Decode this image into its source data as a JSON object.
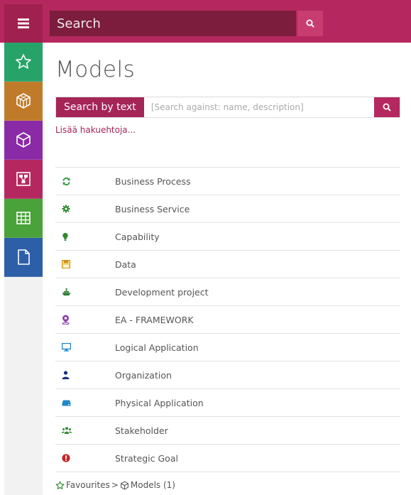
{
  "topbar": {
    "search_placeholder": "Search",
    "menu_icon": "hamburger-icon",
    "search_icon": "search-icon",
    "color": "#b5285f"
  },
  "sidebar": {
    "items": [
      {
        "name": "favourites",
        "icon": "star-icon",
        "color": "#27a36a"
      },
      {
        "name": "objects",
        "icon": "cubes-icon",
        "color": "#c07b2a"
      },
      {
        "name": "models",
        "icon": "cube-icon",
        "color": "#8a2aa6"
      },
      {
        "name": "diagrams",
        "icon": "diagram-icon",
        "color": "#b5285f"
      },
      {
        "name": "tables",
        "icon": "table-icon",
        "color": "#4aa23a"
      },
      {
        "name": "documents",
        "icon": "document-icon",
        "color": "#2c5fa8"
      }
    ]
  },
  "main": {
    "title": "Models",
    "search_label": "Search by text",
    "search_placeholder": "[Search against: name, description]",
    "more_criteria": "Lisää hakuehtoja..."
  },
  "models": [
    {
      "name": "Business Process",
      "icon": "refresh-icon",
      "color": "#2e9a3a"
    },
    {
      "name": "Business Service",
      "icon": "gear-icon",
      "color": "#2e8a2e"
    },
    {
      "name": "Capability",
      "icon": "lightbulb-icon",
      "color": "#2e8a2e"
    },
    {
      "name": "Data",
      "icon": "save-icon",
      "color": "#d9a521"
    },
    {
      "name": "Development project",
      "icon": "ship-icon",
      "color": "#2e7d32"
    },
    {
      "name": "EA - FRAMEWORK",
      "icon": "map-marker-icon",
      "color": "#8e3db3"
    },
    {
      "name": "Logical Application",
      "icon": "monitor-icon",
      "color": "#1e88c8"
    },
    {
      "name": "Organization",
      "icon": "user-icon",
      "color": "#1a2f7a"
    },
    {
      "name": "Physical Application",
      "icon": "server-icon",
      "color": "#1e88c8"
    },
    {
      "name": "Stakeholder",
      "icon": "users-icon",
      "color": "#2e8a2e"
    },
    {
      "name": "Strategic Goal",
      "icon": "exclamation-icon",
      "color": "#c62828"
    }
  ],
  "breadcrumb": {
    "favourites": "Favourites",
    "separator": ">",
    "models": "Models (1)"
  }
}
